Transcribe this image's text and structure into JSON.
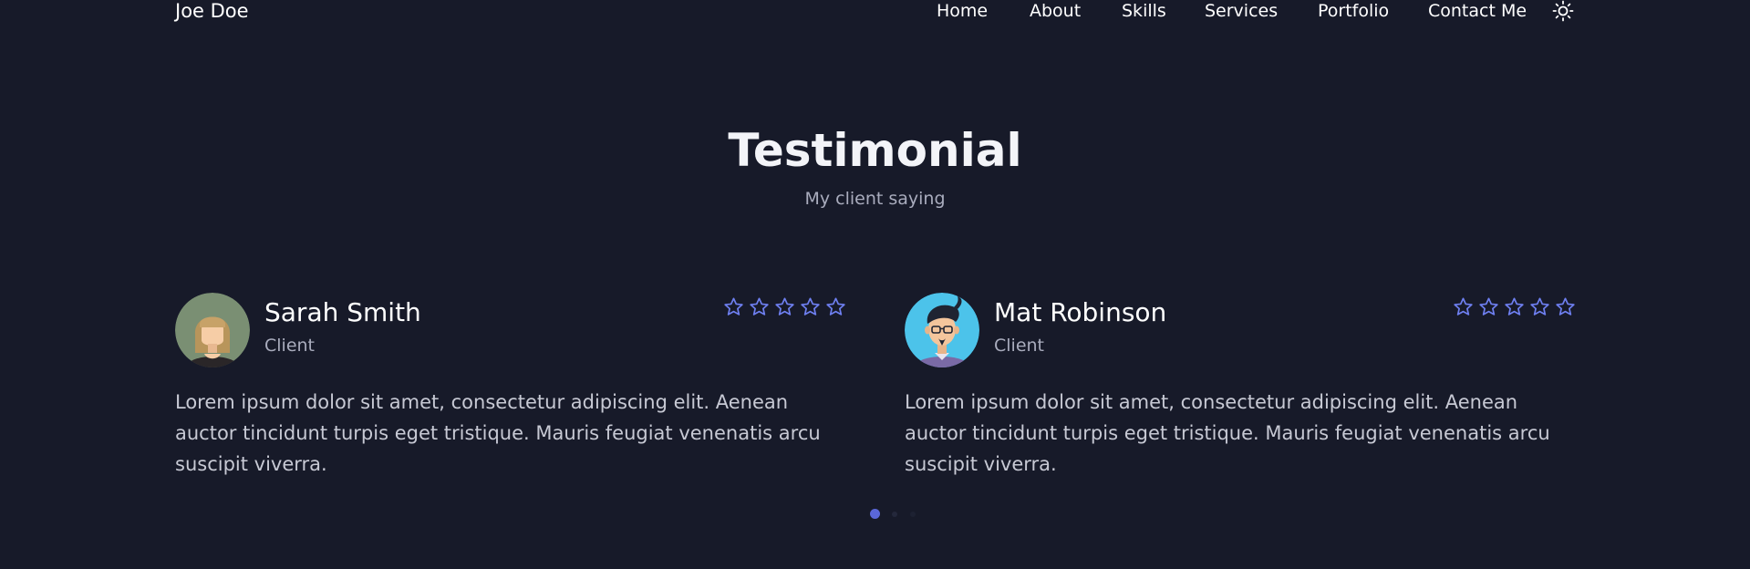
{
  "header": {
    "logo": "Joe Doe",
    "nav": [
      "Home",
      "About",
      "Skills",
      "Services",
      "Portfolio",
      "Contact Me"
    ],
    "theme_icon": "sun-icon"
  },
  "section": {
    "title": "Testimonial",
    "subtitle": "My client saying"
  },
  "testimonials": [
    {
      "name": "Sarah Smith",
      "role": "Client",
      "rating_icon": "star-outline-icon",
      "star_count": 5,
      "text": "Lorem ipsum dolor sit amet, consectetur adipiscing elit. Aenean auctor tincidunt turpis eget tristique. Mauris feugiat venenatis arcu suscipit viverra."
    },
    {
      "name": "Mat Robinson",
      "role": "Client",
      "rating_icon": "star-outline-icon",
      "star_count": 5,
      "text": "Lorem ipsum dolor sit amet, consectetur adipiscing elit. Aenean auctor tincidunt turpis eget tristique. Mauris feugiat venenatis arcu suscipit viverra."
    }
  ],
  "pagination": {
    "count": 3,
    "active": 1
  },
  "colors": {
    "background": "#171a29",
    "accent": "#5a67d8",
    "text": "#ffffff",
    "muted": "#a9acbd"
  }
}
